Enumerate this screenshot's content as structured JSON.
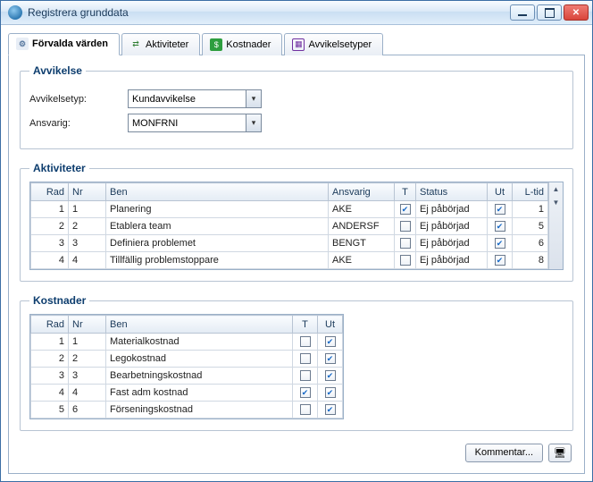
{
  "window": {
    "title": "Registrera grunddata"
  },
  "tabs": [
    {
      "label": "Förvalda värden",
      "active": true
    },
    {
      "label": "Aktiviteter"
    },
    {
      "label": "Kostnader"
    },
    {
      "label": "Avvikelsetyper"
    }
  ],
  "avvikelse": {
    "legend": "Avvikelse",
    "typ_label": "Avvikelsetyp:",
    "typ_value": "Kundavvikelse",
    "ansvarig_label": "Ansvarig:",
    "ansvarig_value": "MONFRNI"
  },
  "aktiviteter": {
    "legend": "Aktiviteter",
    "cols": {
      "rad": "Rad",
      "nr": "Nr",
      "ben": "Ben",
      "ansvarig": "Ansvarig",
      "t": "T",
      "status": "Status",
      "ut": "Ut",
      "ltid": "L-tid"
    },
    "rows": [
      {
        "rad": "1",
        "nr": "1",
        "ben": "Planering",
        "ansvarig": "AKE",
        "t": true,
        "status": "Ej påbörjad",
        "ut": true,
        "ltid": "1"
      },
      {
        "rad": "2",
        "nr": "2",
        "ben": "Etablera team",
        "ansvarig": "ANDERSF",
        "t": false,
        "status": "Ej påbörjad",
        "ut": true,
        "ltid": "5"
      },
      {
        "rad": "3",
        "nr": "3",
        "ben": "Definiera problemet",
        "ansvarig": "BENGT",
        "t": false,
        "status": "Ej påbörjad",
        "ut": true,
        "ltid": "6"
      },
      {
        "rad": "4",
        "nr": "4",
        "ben": "Tillfällig problemstoppare",
        "ansvarig": "AKE",
        "t": false,
        "status": "Ej påbörjad",
        "ut": true,
        "ltid": "8"
      }
    ]
  },
  "kostnader": {
    "legend": "Kostnader",
    "cols": {
      "rad": "Rad",
      "nr": "Nr",
      "ben": "Ben",
      "t": "T",
      "ut": "Ut"
    },
    "rows": [
      {
        "rad": "1",
        "nr": "1",
        "ben": "Materialkostnad",
        "t": false,
        "ut": true
      },
      {
        "rad": "2",
        "nr": "2",
        "ben": "Legokostnad",
        "t": false,
        "ut": true
      },
      {
        "rad": "3",
        "nr": "3",
        "ben": "Bearbetningskostnad",
        "t": false,
        "ut": true
      },
      {
        "rad": "4",
        "nr": "4",
        "ben": "Fast adm kostnad",
        "t": true,
        "ut": true
      },
      {
        "rad": "5",
        "nr": "6",
        "ben": "Förseningskostnad",
        "t": false,
        "ut": true
      }
    ]
  },
  "buttons": {
    "kommentar": "Kommentar..."
  }
}
